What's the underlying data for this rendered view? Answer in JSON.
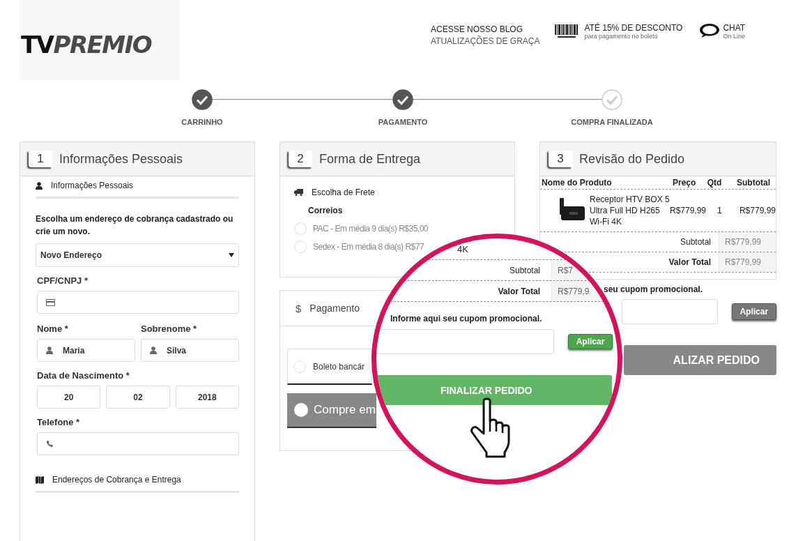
{
  "header": {
    "logo": [
      "TV",
      "PREMIO"
    ],
    "blog": {
      "title": "ACESSE NOSSO BLOG",
      "subtitle": "ATUALIZAÇÕES DE GRAÇA"
    },
    "discount": {
      "title": "ATÉ 15% DE DESCONTO",
      "subtitle": "para pagamento no boleto"
    },
    "chat": {
      "title": "CHAT",
      "subtitle": "On Line"
    }
  },
  "steps": [
    {
      "label": "CARRINHO",
      "done": true
    },
    {
      "label": "PAGAMENTO",
      "done": true
    },
    {
      "label": "COMPRA FINALIZADA",
      "done": false
    }
  ],
  "personal": {
    "number": "1",
    "title": "Informações Pessoais",
    "section": "Informações Pessoais",
    "address_prompt": "Escolha um endereço de cobrança cadastrado ou crie um novo.",
    "address_select": "Novo Endereço",
    "cpf": {
      "label": "CPF/CNPJ *"
    },
    "first_name": {
      "label": "Nome *",
      "value": "Maria"
    },
    "last_name": {
      "label": "Sobrenome *",
      "value": "Silva"
    },
    "birth": {
      "label": "Data de Nascimento *",
      "day": "20",
      "month": "02",
      "year": "2018"
    },
    "phone": {
      "label": "Telefone *"
    },
    "address_section": "Endereços de Cobrança e Entrega"
  },
  "shipping": {
    "number": "2",
    "title": "Forma de Entrega",
    "section": "Escolha de Frete",
    "carrier": "Correios",
    "options": [
      {
        "label": "PAC - Em média 9 dia(s) R$35,00",
        "selected": false
      },
      {
        "label": "Sedex - Em média 8 dia(s) R$77",
        "selected": false
      }
    ]
  },
  "payment": {
    "symbol": "$",
    "title": "Pagamento",
    "options": [
      {
        "kind": "radio",
        "label": "Boleto bancár",
        "selected": false
      },
      {
        "kind": "bar",
        "label": "Compre em",
        "selected": false
      }
    ]
  },
  "review": {
    "number": "3",
    "title": "Revisão do Pedido",
    "columns": [
      "Nome do Produto",
      "Preço",
      "Qtd",
      "Subtotal"
    ],
    "rows": [
      {
        "product": "Receptor HTV BOX 5 Ultra Full HD H265 Wi-Fi 4K",
        "price": "R$779,99",
        "qty": "1",
        "subtotal": "R$779,99"
      }
    ],
    "totals": [
      {
        "label": "Subtotal",
        "value": "R$779,99"
      },
      {
        "label": "Valor Total",
        "value": "R$779,99"
      }
    ]
  },
  "coupon": {
    "label": "seu cupom promocional.",
    "button": "Aplicar"
  },
  "finish_button": "ALIZAR PEDIDO",
  "magnifier": {
    "fragment": "4K",
    "totals": [
      {
        "label": "Subtotal",
        "value": "R$7"
      },
      {
        "label": "Valor Total",
        "value": "R$779,9"
      }
    ],
    "coupon_label": "Informe aqui seu cupom promocional.",
    "coupon_button": "Aplicar",
    "finish_button": "FINALIZAR PEDIDO"
  }
}
